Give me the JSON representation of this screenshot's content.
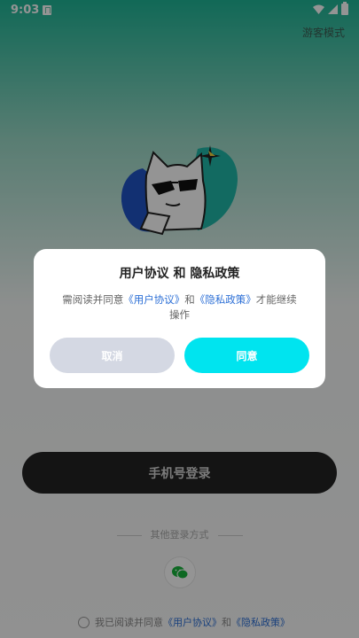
{
  "status_bar": {
    "time": "9:03",
    "icons": [
      "notification-a-icon",
      "wifi-icon",
      "signal-icon",
      "battery-icon"
    ]
  },
  "header": {
    "guest_mode_label": "游客模式"
  },
  "login": {
    "phone_login_label": "手机号登录",
    "other_methods_label": "其他登录方式",
    "wechat_icon": "wechat-icon",
    "agreement": {
      "prefix": "我已阅读并同意",
      "user_agreement": "《用户协议》",
      "and": "和",
      "privacy_policy": "《隐私政策》"
    }
  },
  "dialog": {
    "title": "用户协议 和 隐私政策",
    "body_prefix": "需阅读并同意",
    "user_agreement_link": "《用户协议》",
    "and": "和",
    "privacy_policy_link": "《隐私政策》",
    "body_suffix": "才能继续操作",
    "cancel_label": "取消",
    "agree_label": "同意"
  },
  "colors": {
    "agree_button": "#00e4ef",
    "cancel_button": "#d4d8e3",
    "link": "#2c6fd6",
    "brand_top": "#1fb596"
  }
}
